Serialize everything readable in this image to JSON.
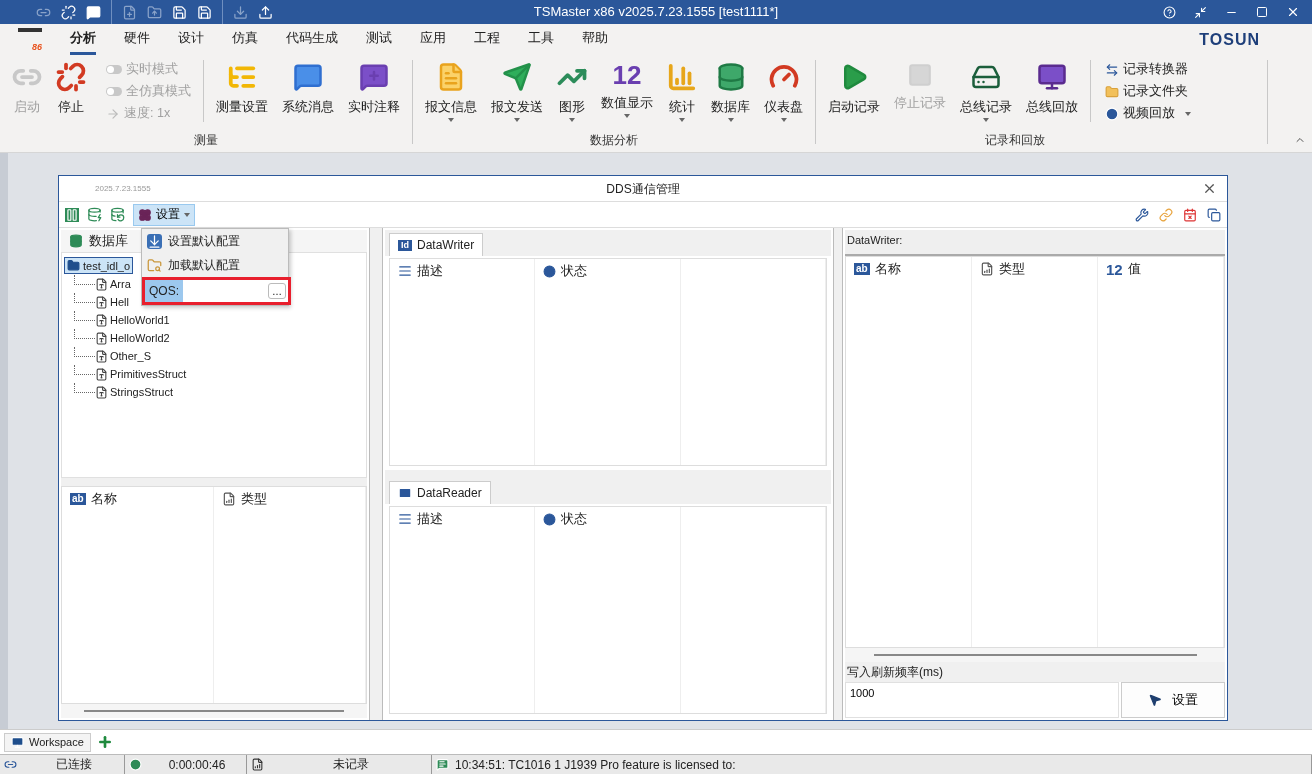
{
  "title_bar": {
    "title": "TSMaster x86 v2025.7.23.1555 [test1111*]"
  },
  "logo_text": "86",
  "menu_tabs": [
    {
      "label": "分析",
      "selected": true
    },
    {
      "label": "硬件",
      "selected": false
    },
    {
      "label": "设计",
      "selected": false
    },
    {
      "label": "仿真",
      "selected": false
    },
    {
      "label": "代码生成",
      "selected": false
    },
    {
      "label": "测试",
      "selected": false
    },
    {
      "label": "应用",
      "selected": false
    },
    {
      "label": "工程",
      "selected": false
    },
    {
      "label": "工具",
      "selected": false
    },
    {
      "label": "帮助",
      "selected": false
    }
  ],
  "brand": "TOSUN",
  "ribbon_groups": [
    {
      "label": "测量",
      "items": [
        {
          "kind": "large",
          "label": "启动",
          "disabled": true,
          "dropdown": false
        },
        {
          "kind": "large",
          "label": "停止",
          "disabled": false,
          "dropdown": false
        },
        {
          "kind": "stack",
          "entries": [
            {
              "kind": "switch",
              "label": "实时模式",
              "on": false,
              "disabled": true
            },
            {
              "kind": "switch",
              "label": "全仿真模式",
              "on": false,
              "disabled": true
            },
            {
              "kind": "action",
              "label": "速度: 1x",
              "disabled": true,
              "dropdown": false
            }
          ]
        },
        {
          "kind": "large",
          "label": "测量设置",
          "disabled": false,
          "dropdown": false
        },
        {
          "kind": "large",
          "label": "系统消息",
          "disabled": false,
          "dropdown": false
        },
        {
          "kind": "large",
          "label": "实时注释",
          "disabled": false,
          "dropdown": false
        }
      ]
    },
    {
      "label": "数据分析",
      "items": [
        {
          "kind": "large",
          "label": "报文信息",
          "disabled": false,
          "dropdown": true
        },
        {
          "kind": "large",
          "label": "报文发送",
          "disabled": false,
          "dropdown": true
        },
        {
          "kind": "large",
          "label": "图形",
          "disabled": false,
          "dropdown": true
        },
        {
          "kind": "large",
          "label": "数值显示",
          "disabled": false,
          "dropdown": true,
          "icon_text": "12"
        },
        {
          "kind": "large",
          "label": "统计",
          "disabled": false,
          "dropdown": true
        },
        {
          "kind": "large",
          "label": "数据库",
          "disabled": false,
          "dropdown": true
        },
        {
          "kind": "large",
          "label": "仪表盘",
          "disabled": false,
          "dropdown": true
        }
      ]
    },
    {
      "label": "记录和回放",
      "items": [
        {
          "kind": "large",
          "label": "启动记录",
          "disabled": false,
          "dropdown": false
        },
        {
          "kind": "large",
          "label": "停止记录",
          "disabled": true,
          "dropdown": false
        },
        {
          "kind": "large",
          "label": "总线记录",
          "disabled": false,
          "dropdown": true
        },
        {
          "kind": "large",
          "label": "总线回放",
          "disabled": false,
          "dropdown": false
        },
        {
          "kind": "stack",
          "entries": [
            {
              "kind": "action",
              "label": "记录转换器",
              "disabled": false,
              "dropdown": false
            },
            {
              "kind": "action",
              "label": "记录文件夹",
              "disabled": false,
              "dropdown": false
            },
            {
              "kind": "action",
              "label": "视频回放",
              "disabled": false,
              "dropdown": true
            }
          ]
        }
      ]
    }
  ],
  "dds_window": {
    "version": "2025.7.23.1555",
    "title": "DDS通信管理",
    "settings_label": "设置",
    "settings_menu": {
      "items": [
        "设置默认配置",
        "加载默认配置"
      ],
      "qos_label": "QOS:",
      "browse_label": "…"
    },
    "left_panel": {
      "header": "数据库",
      "tree": {
        "label": "test_idl_o",
        "selected": true,
        "children": [
          {
            "label": "Arra"
          },
          {
            "label": "Hell"
          },
          {
            "label": "HelloWorld1"
          },
          {
            "label": "HelloWorld2"
          },
          {
            "label": "Other_S"
          },
          {
            "label": "PrimitivesStruct"
          },
          {
            "label": "StringsStruct"
          }
        ]
      },
      "columns": [
        {
          "label": "名称",
          "icon_text": "ab"
        },
        {
          "label": "类型"
        }
      ]
    },
    "writer": {
      "tab": "DataWriter",
      "tab_icon_text": "Id",
      "columns": [
        {
          "label": "描述"
        },
        {
          "label": "状态"
        }
      ]
    },
    "reader": {
      "tab": "DataReader",
      "columns": [
        {
          "label": "描述"
        },
        {
          "label": "状态"
        }
      ]
    },
    "right_panel": {
      "caption": "DataWriter:",
      "columns": [
        {
          "label": "名称",
          "icon_text": "ab"
        },
        {
          "label": "类型"
        },
        {
          "label": "值",
          "icon_text": "12"
        }
      ],
      "rate_label": "写入刷新频率(ms)",
      "rate_value": "1000",
      "set_button": "设置"
    }
  },
  "workspace_tabs": [
    {
      "label": "Workspace",
      "selected": true
    }
  ],
  "status_bar": [
    "已连接",
    "0:00:00:46",
    "未记录",
    "10:34:51: TC1016 1 J1939 Pro feature is licensed to:"
  ]
}
